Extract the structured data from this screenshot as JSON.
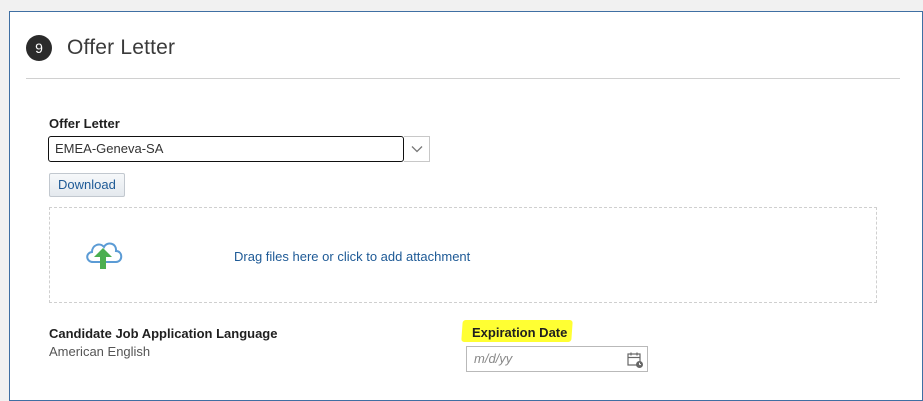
{
  "section": {
    "step_number": "9",
    "title": "Offer Letter"
  },
  "offer_letter": {
    "label": "Offer Letter",
    "selected_value": "EMEA-Geneva-SA",
    "download_label": "Download"
  },
  "attachment": {
    "prompt": "Drag files here or click to add attachment",
    "icon": "cloud-upload-icon"
  },
  "candidate_language": {
    "label": "Candidate Job Application Language",
    "value": "American English"
  },
  "expiration_date": {
    "label": "Expiration Date",
    "placeholder": "m/d/yy",
    "icon": "calendar-icon"
  },
  "colors": {
    "link": "#1e5a96",
    "highlight": "#ffff33",
    "upload_arrow": "#4caf50",
    "upload_cloud": "#5b9bd5"
  }
}
